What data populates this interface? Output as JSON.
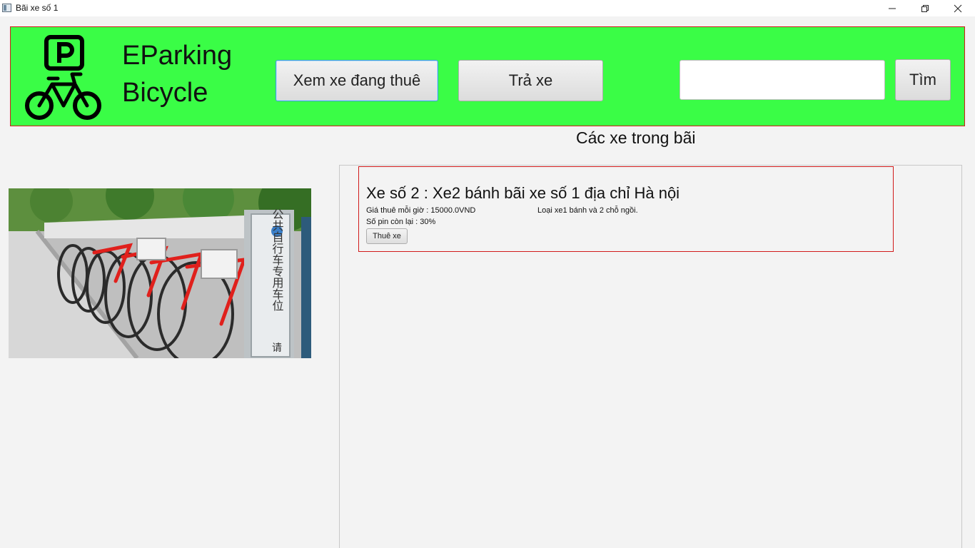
{
  "window": {
    "title": "Bãi xe số 1"
  },
  "header": {
    "brand_line1": "EParking",
    "brand_line2": "Bicycle",
    "view_rented_label": "Xem xe đang thuê",
    "return_label": "Trả xe",
    "search_value": "",
    "search_label": "Tìm",
    "bg_color": "#3afd46",
    "border_color": "#d11a1a"
  },
  "list": {
    "title": "Các xe trong bãi",
    "items": [
      {
        "title": "Xe số 2 : Xe2 bánh bãi xe số 1 địa chỉ Hà nội",
        "price": "Giá thuê mỗi giờ : 15000.0VND",
        "type": "Loại xe1 bánh và 2 chỗ ngồi.",
        "battery": "Số pin còn lại : 30%",
        "rent_label": "Thuê xe"
      }
    ]
  },
  "photo": {
    "sign_text": "公共自行车专用车位",
    "sign_suffix": "请"
  }
}
